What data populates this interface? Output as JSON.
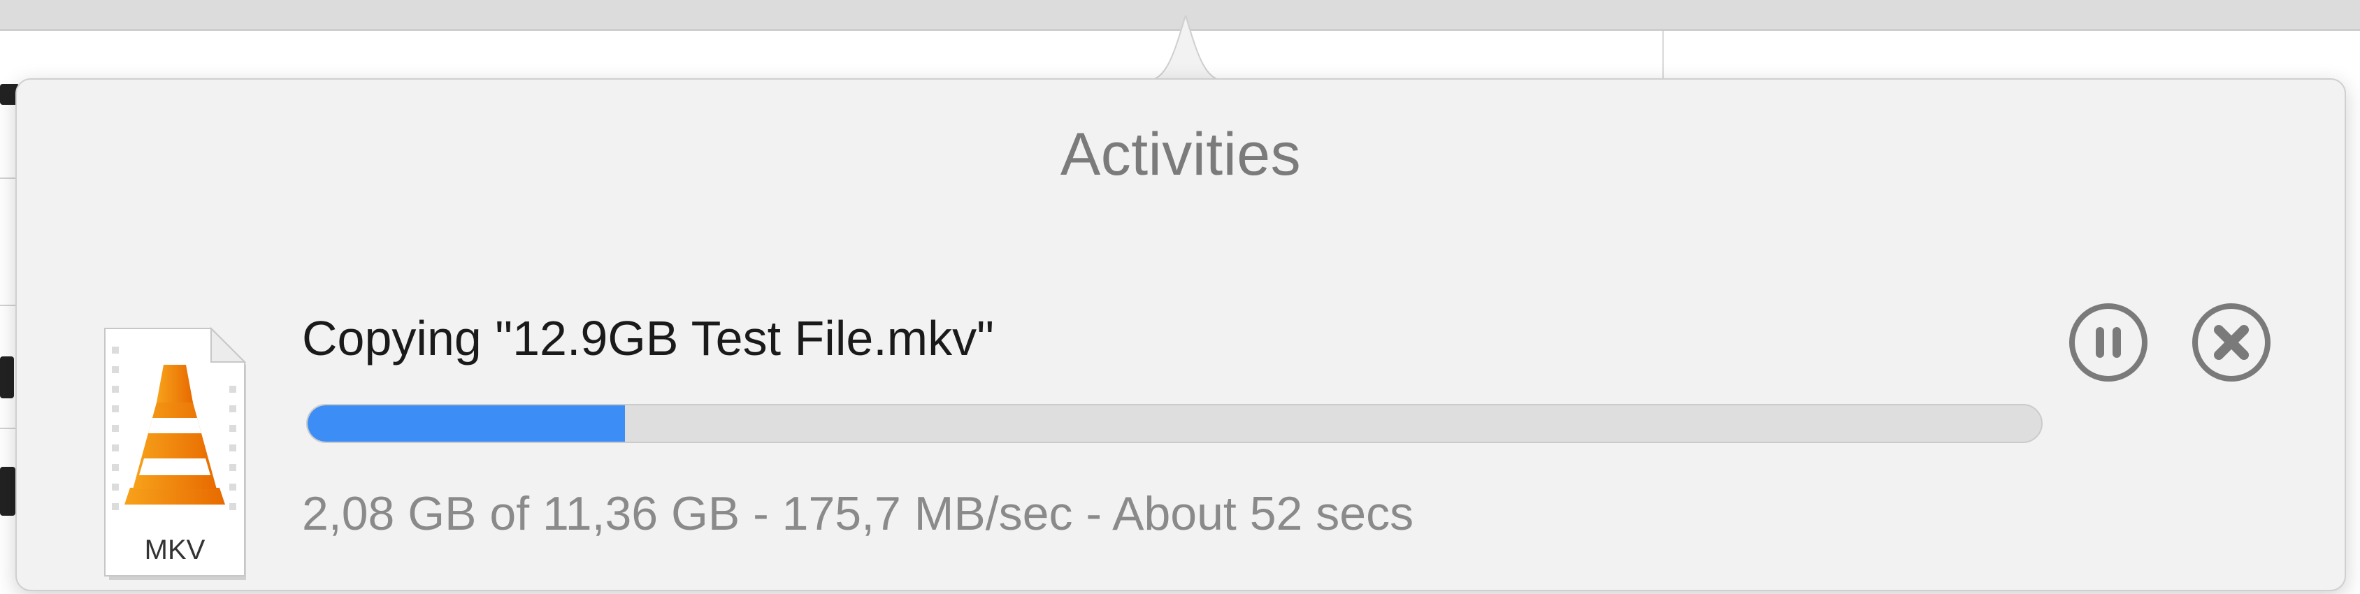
{
  "popover": {
    "title": "Activities"
  },
  "activity": {
    "file_icon": {
      "name": "vlc-mkv-file-icon",
      "label": "MKV"
    },
    "title": "Copying \"12.9GB Test File.mkv\"",
    "progress": 0.183,
    "status": "2,08 GB of 11,36 GB - 175,7 MB/sec - About 52 secs",
    "pause_icon": "pause-circle-icon",
    "stop_icon": "stop-circle-icon"
  },
  "colors": {
    "progress_fill": "#3d8df6",
    "progress_track": "#dedede",
    "title_text": "#7b7b7b",
    "status_text": "#8a8a8a",
    "cone_orange": "#f57c00"
  }
}
